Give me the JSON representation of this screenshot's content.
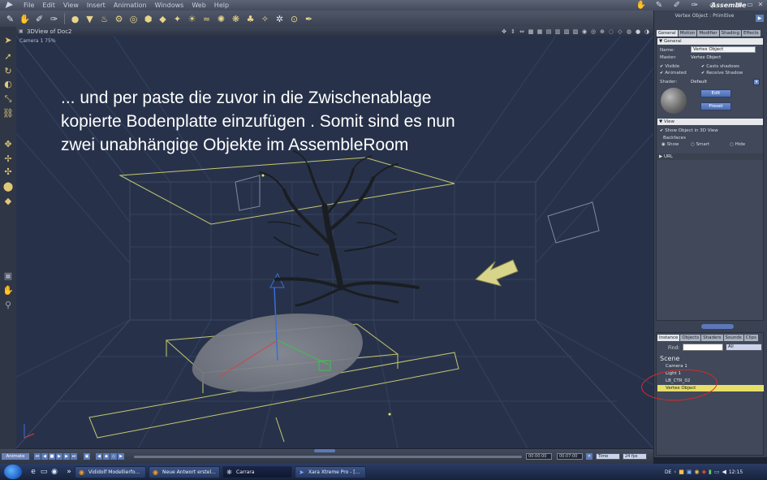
{
  "menubar": {
    "items": [
      "File",
      "Edit",
      "View",
      "Insert",
      "Animation",
      "Windows",
      "Web",
      "Help"
    ],
    "room_label": "Assemble"
  },
  "toolbar": {
    "tools": [
      "pencil-icon",
      "hand-icon",
      "brush-icon",
      "wrench-icon",
      "sphere-icon",
      "cone-icon",
      "teapot-icon",
      "wire-icon",
      "torus-icon",
      "plane-icon",
      "cube-icon",
      "light-icon",
      "spot-icon",
      "wave-icon",
      "bulb-icon",
      "creature-icon",
      "figure-icon",
      "sparkle-icon",
      "particle-icon",
      "target-icon",
      "pin-icon"
    ]
  },
  "viewport": {
    "title": "3DView of Doc2",
    "camera_label": "Camera 1 75%",
    "annotation_lines": [
      "... und per paste  die zuvor in die Zwischenablage",
      "kopierte Bodenplatte einzufügen . Somit sind es nun",
      "zwei unabhängige Objekte  im AssembleRoom"
    ]
  },
  "properties": {
    "title": "Vertex Object : Primitive",
    "tabs": [
      "General",
      "Motion",
      "Modifier",
      "Shading",
      "Effects"
    ],
    "general_header": "General",
    "name_label": "Name:",
    "name_value": "Vertex Object",
    "master_label": "Master:",
    "master_value": "Vertex Object",
    "visible": "Visible",
    "casts_shadows": "Casts shadows",
    "animated": "Animated",
    "receive_shadow": "Receive Shadow",
    "shader_label": "Shader:",
    "shader_value": "Default",
    "edit_button": "Edit",
    "preset_button": "Preset",
    "view_header": "View",
    "show_in_3d": "Show Object in 3D View",
    "backfaces_label": "Backfaces",
    "backface_options": [
      "Show",
      "Smart",
      "Hide"
    ],
    "url_header": "URL"
  },
  "instances": {
    "tabs": [
      "Instance",
      "Objects",
      "Shaders",
      "Sounds",
      "Clips"
    ],
    "find_label": "Find:",
    "find_scope": "All",
    "scene_label": "Scene",
    "rows": [
      "Camera 1",
      "Light 1",
      "LB_CTR_02",
      "Vertex Object"
    ],
    "selected_index": 3
  },
  "timeline": {
    "animate_label": "Animate",
    "time_current": "00:00:00",
    "time_end": "00:07:00",
    "time_mode": "Time",
    "fps": "24 fps"
  },
  "taskbar": {
    "tasks": [
      "Vididolf Modellierfo...",
      "Neue Antwort erstel...",
      "Carrara",
      "Xara Xtreme Pro - [..."
    ],
    "active_index": 2,
    "language": "DE",
    "clock": "12:15"
  },
  "colors": {
    "viewport_bg": "#27324a",
    "grid": "#3b4a66",
    "wire_yellow": "#c8c870",
    "selection_yellow": "#e7df6a",
    "highlight_red": "#e02828"
  }
}
